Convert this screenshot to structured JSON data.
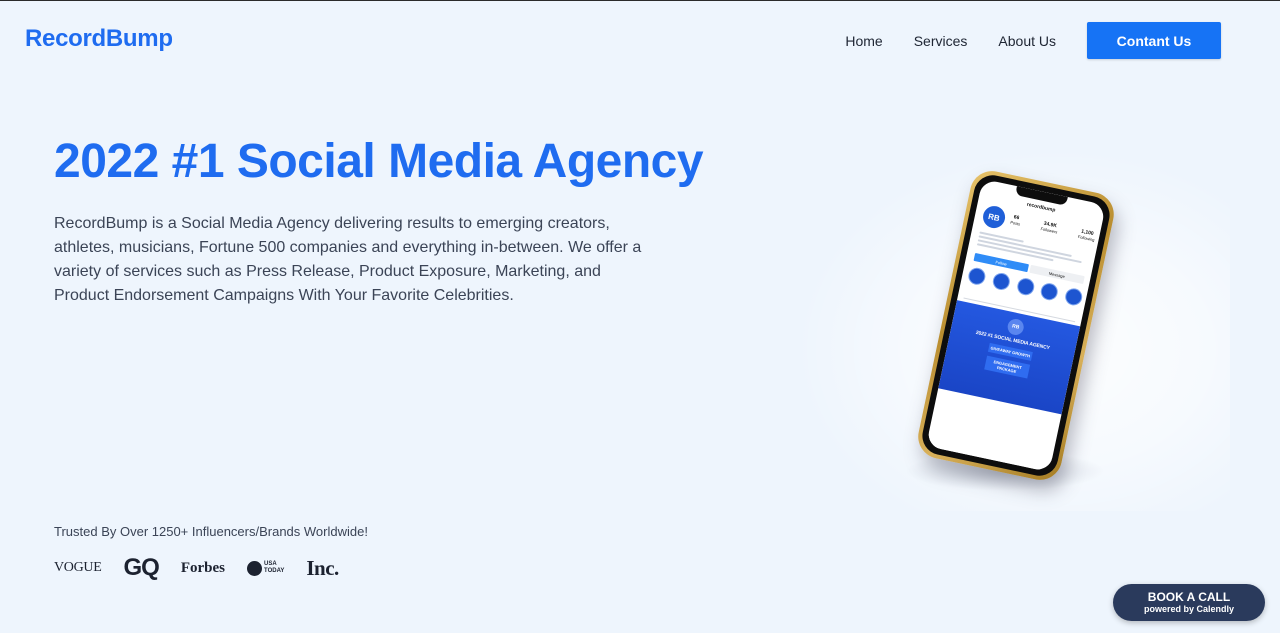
{
  "header": {
    "logo": "RecordBump",
    "nav": [
      "Home",
      "Services",
      "About Us"
    ],
    "cta": "Contant Us"
  },
  "hero": {
    "title": "2022 #1 Social Media Agency",
    "description": "RecordBump is a Social Media Agency delivering results to emerging creators, athletes, musicians, Fortune 500 companies and everything in-between. We offer a variety of services such as Press Release, Product Exposure, Marketing, and Product Endorsement Campaigns With Your Favorite Celebrities."
  },
  "trusted": {
    "text": "Trusted By Over 1250+ Influencers/Brands Worldwide!",
    "logos": {
      "vogue": "VOGUE",
      "gq": "GQ",
      "forbes": "Forbes",
      "usa_today_top": "USA",
      "usa_today_bottom": "TODAY",
      "inc": "Inc."
    }
  },
  "phone": {
    "username": "recordbump",
    "avatar": "RB",
    "stats": [
      {
        "value": "66",
        "label": "Posts"
      },
      {
        "value": "34.9K",
        "label": "Followers"
      },
      {
        "value": "1,100",
        "label": "Following"
      }
    ],
    "follow": "Follow",
    "message": "Message",
    "post_logo": "RB",
    "post_title": "2022 #1 SOCIAL MEDIA AGENCY",
    "post_box_1": "GIVEAWAY GROWTH",
    "post_box_2": "ENGAGEMENT PACKAGE"
  },
  "calendly": {
    "main": "BOOK A CALL",
    "sub": "powered by Calendly"
  },
  "colors": {
    "brand_blue": "#1f6cf0",
    "button_blue": "#1673f5",
    "background": "#eef5fd",
    "calendly_bg": "#2a3a5c"
  }
}
